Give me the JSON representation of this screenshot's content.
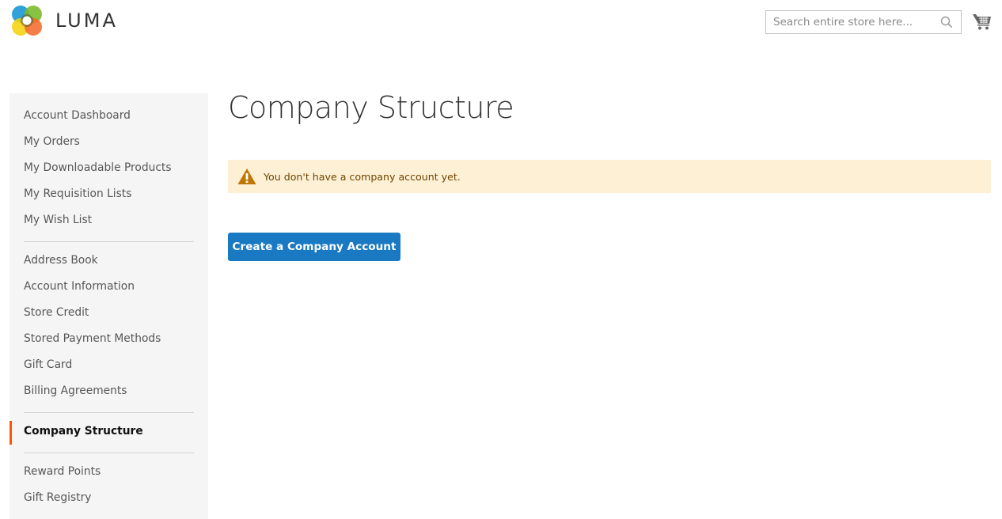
{
  "header": {
    "logo_text": "LUMA",
    "search": {
      "placeholder": "Search entire store here...",
      "value": ""
    },
    "icons": {
      "search": "search-icon",
      "cart": "cart-icon"
    }
  },
  "sidebar": {
    "groups": [
      [
        {
          "label": "Account Dashboard",
          "current": false
        },
        {
          "label": "My Orders",
          "current": false
        },
        {
          "label": "My Downloadable Products",
          "current": false
        },
        {
          "label": "My Requisition Lists",
          "current": false
        },
        {
          "label": "My Wish List",
          "current": false
        }
      ],
      [
        {
          "label": "Address Book",
          "current": false
        },
        {
          "label": "Account Information",
          "current": false
        },
        {
          "label": "Store Credit",
          "current": false
        },
        {
          "label": "Stored Payment Methods",
          "current": false
        },
        {
          "label": "Gift Card",
          "current": false
        },
        {
          "label": "Billing Agreements",
          "current": false
        }
      ],
      [
        {
          "label": "Company Structure",
          "current": true
        }
      ],
      [
        {
          "label": "Reward Points",
          "current": false
        },
        {
          "label": "Gift Registry",
          "current": false
        }
      ]
    ],
    "accent_color": "#ff5501"
  },
  "main": {
    "title": "Company Structure",
    "notice": {
      "type": "warning",
      "icon": "warning-icon",
      "text": "You don't have a company account yet."
    },
    "create_button_label": "Create a Company Account",
    "button_color": "#1979c3"
  }
}
